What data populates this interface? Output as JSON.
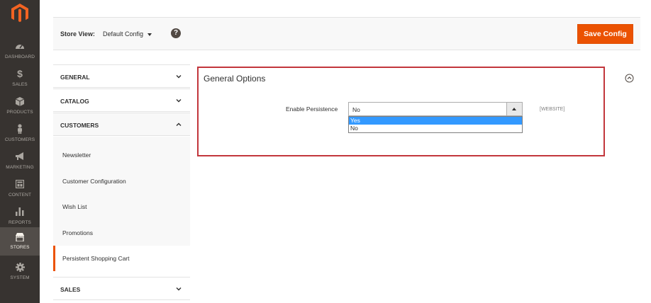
{
  "sidebar": {
    "logo": "magento-logo",
    "items": [
      {
        "label": "DASHBOARD",
        "icon": "dashboard-icon"
      },
      {
        "label": "SALES",
        "icon": "dollar-icon"
      },
      {
        "label": "PRODUCTS",
        "icon": "cube-icon"
      },
      {
        "label": "CUSTOMERS",
        "icon": "person-icon"
      },
      {
        "label": "MARKETING",
        "icon": "megaphone-icon"
      },
      {
        "label": "CONTENT",
        "icon": "layout-icon"
      },
      {
        "label": "REPORTS",
        "icon": "bar-chart-icon"
      },
      {
        "label": "STORES",
        "icon": "store-icon",
        "active": true
      },
      {
        "label": "SYSTEM",
        "icon": "gear-icon"
      }
    ],
    "colors": {
      "bg": "#373330",
      "active_bg": "#524d49",
      "text": "#aaa6a0"
    }
  },
  "header": {
    "store_view_label": "Store View:",
    "store_view_value": "Default Config",
    "help_icon": "?",
    "save_label": "Save Config"
  },
  "tabs": {
    "groups": [
      {
        "label": "GENERAL",
        "state": "collapsed"
      },
      {
        "label": "CATALOG",
        "state": "collapsed"
      },
      {
        "label": "CUSTOMERS",
        "state": "expanded"
      },
      {
        "label": "SALES",
        "state": "collapsed"
      }
    ],
    "customer_items": [
      {
        "label": "Newsletter"
      },
      {
        "label": "Customer Configuration"
      },
      {
        "label": "Wish List"
      },
      {
        "label": "Promotions"
      },
      {
        "label": "Persistent Shopping Cart",
        "active": true
      }
    ]
  },
  "main": {
    "section_title": "General Options",
    "field": {
      "label": "Enable Persistence",
      "value": "No",
      "scope": "[WEBSITE]",
      "options": [
        {
          "label": "Yes",
          "highlighted": true
        },
        {
          "label": "No",
          "highlighted": false
        }
      ]
    }
  },
  "colors": {
    "accent": "#eb5202",
    "highlight_border": "#c2363c",
    "option_highlight": "#3399ff"
  }
}
